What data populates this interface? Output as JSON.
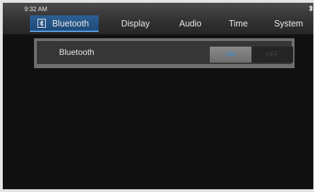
{
  "status_bar": {
    "time": "9:32 AM",
    "bluetooth_icon": "bluetooth-icon"
  },
  "tabs": [
    {
      "label": "Bluetooth",
      "icon": "bluetooth-icon",
      "active": true
    },
    {
      "label": "Display",
      "active": false
    },
    {
      "label": "Audio",
      "active": false
    },
    {
      "label": "Time",
      "active": false
    },
    {
      "label": "System",
      "active": false
    }
  ],
  "settings": {
    "bluetooth_row": {
      "label": "Bluetooth",
      "toggle": {
        "on_label": "ON",
        "off_label": "OFF",
        "selected": "ON"
      }
    }
  },
  "colors": {
    "accent": "#2d5f94",
    "toggle_on_text": "#2f8fe0",
    "background": "#111111"
  }
}
